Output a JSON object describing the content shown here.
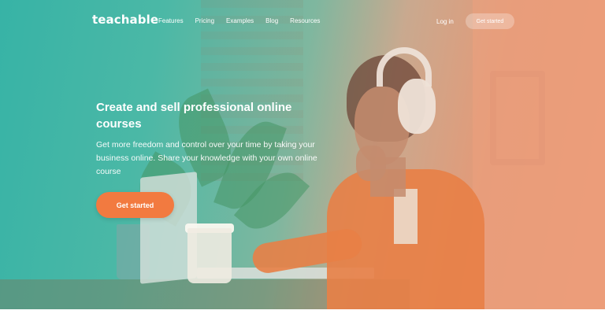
{
  "brand": {
    "logo_text": "teachable"
  },
  "nav": {
    "links": [
      {
        "label": "Features"
      },
      {
        "label": "Pricing"
      },
      {
        "label": "Examples"
      },
      {
        "label": "Blog"
      },
      {
        "label": "Resources"
      }
    ],
    "login_label": "Log in",
    "cta_label": "Get started"
  },
  "hero": {
    "headline": "Create and sell professional online courses",
    "subheadline": "Get more freedom and control over your time by taking your business online. Share your knowledge with your own online course",
    "cta_label": "Get started",
    "accent_color": "#f27a40"
  }
}
